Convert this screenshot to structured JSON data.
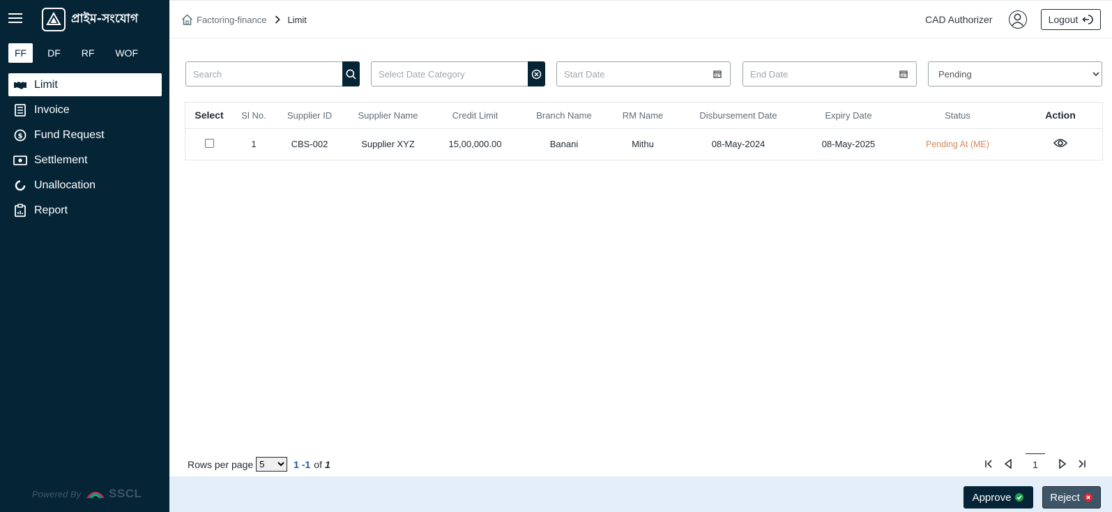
{
  "app": {
    "logo_text": "প্রাইম-সংযোগ",
    "powered_by": "Powered By",
    "vendor": "SSCL"
  },
  "module_tabs": [
    {
      "label": "FF",
      "active": true
    },
    {
      "label": "DF",
      "active": false
    },
    {
      "label": "RF",
      "active": false
    },
    {
      "label": "WOF",
      "active": false
    }
  ],
  "nav": [
    {
      "label": "Limit",
      "icon": "handshake-icon",
      "active": true
    },
    {
      "label": "Invoice",
      "icon": "document-list-icon",
      "active": false
    },
    {
      "label": "Fund Request",
      "icon": "dollar-circle-icon",
      "active": false
    },
    {
      "label": "Settlement",
      "icon": "banknote-icon",
      "active": false
    },
    {
      "label": "Unallocation",
      "icon": "circle-refresh-icon",
      "active": false
    },
    {
      "label": "Report",
      "icon": "clipboard-chart-icon",
      "active": false
    }
  ],
  "header": {
    "breadcrumb": {
      "home": "Factoring-finance",
      "current": "Limit"
    },
    "user_role": "CAD Authorizer",
    "logout_label": "Logout"
  },
  "filters": {
    "search_placeholder": "Search",
    "date_category_placeholder": "Select Date Category",
    "start_date_placeholder": "Start Date",
    "end_date_placeholder": "End Date",
    "status_value": "Pending"
  },
  "table": {
    "columns": [
      "Select",
      "Sl No.",
      "Supplier ID",
      "Supplier Name",
      "Credit Limit",
      "Branch Name",
      "RM Name",
      "Disbursement Date",
      "Expiry Date",
      "Status",
      "Action"
    ],
    "rows": [
      {
        "sl": "1",
        "supplier_id": "CBS-002",
        "supplier_name": "Supplier XYZ",
        "credit_limit": "15,00,000.00",
        "branch": "Banani",
        "rm": "Mithu",
        "disbursement": "08-May-2024",
        "expiry": "08-May-2025",
        "status": "Pending At (ME)"
      }
    ]
  },
  "pagination": {
    "rows_per_page_label": "Rows per page",
    "rows_per_page": "5",
    "range": "1 -1",
    "of": "of",
    "total": "1",
    "current_page": "1"
  },
  "actions": {
    "approve": "Approve",
    "reject": "Reject"
  },
  "colors": {
    "sidebar": "#052537",
    "status_pending": "#d4895a",
    "approve": "#052537",
    "reject": "#3d5566",
    "footer": "#e4eef8"
  }
}
